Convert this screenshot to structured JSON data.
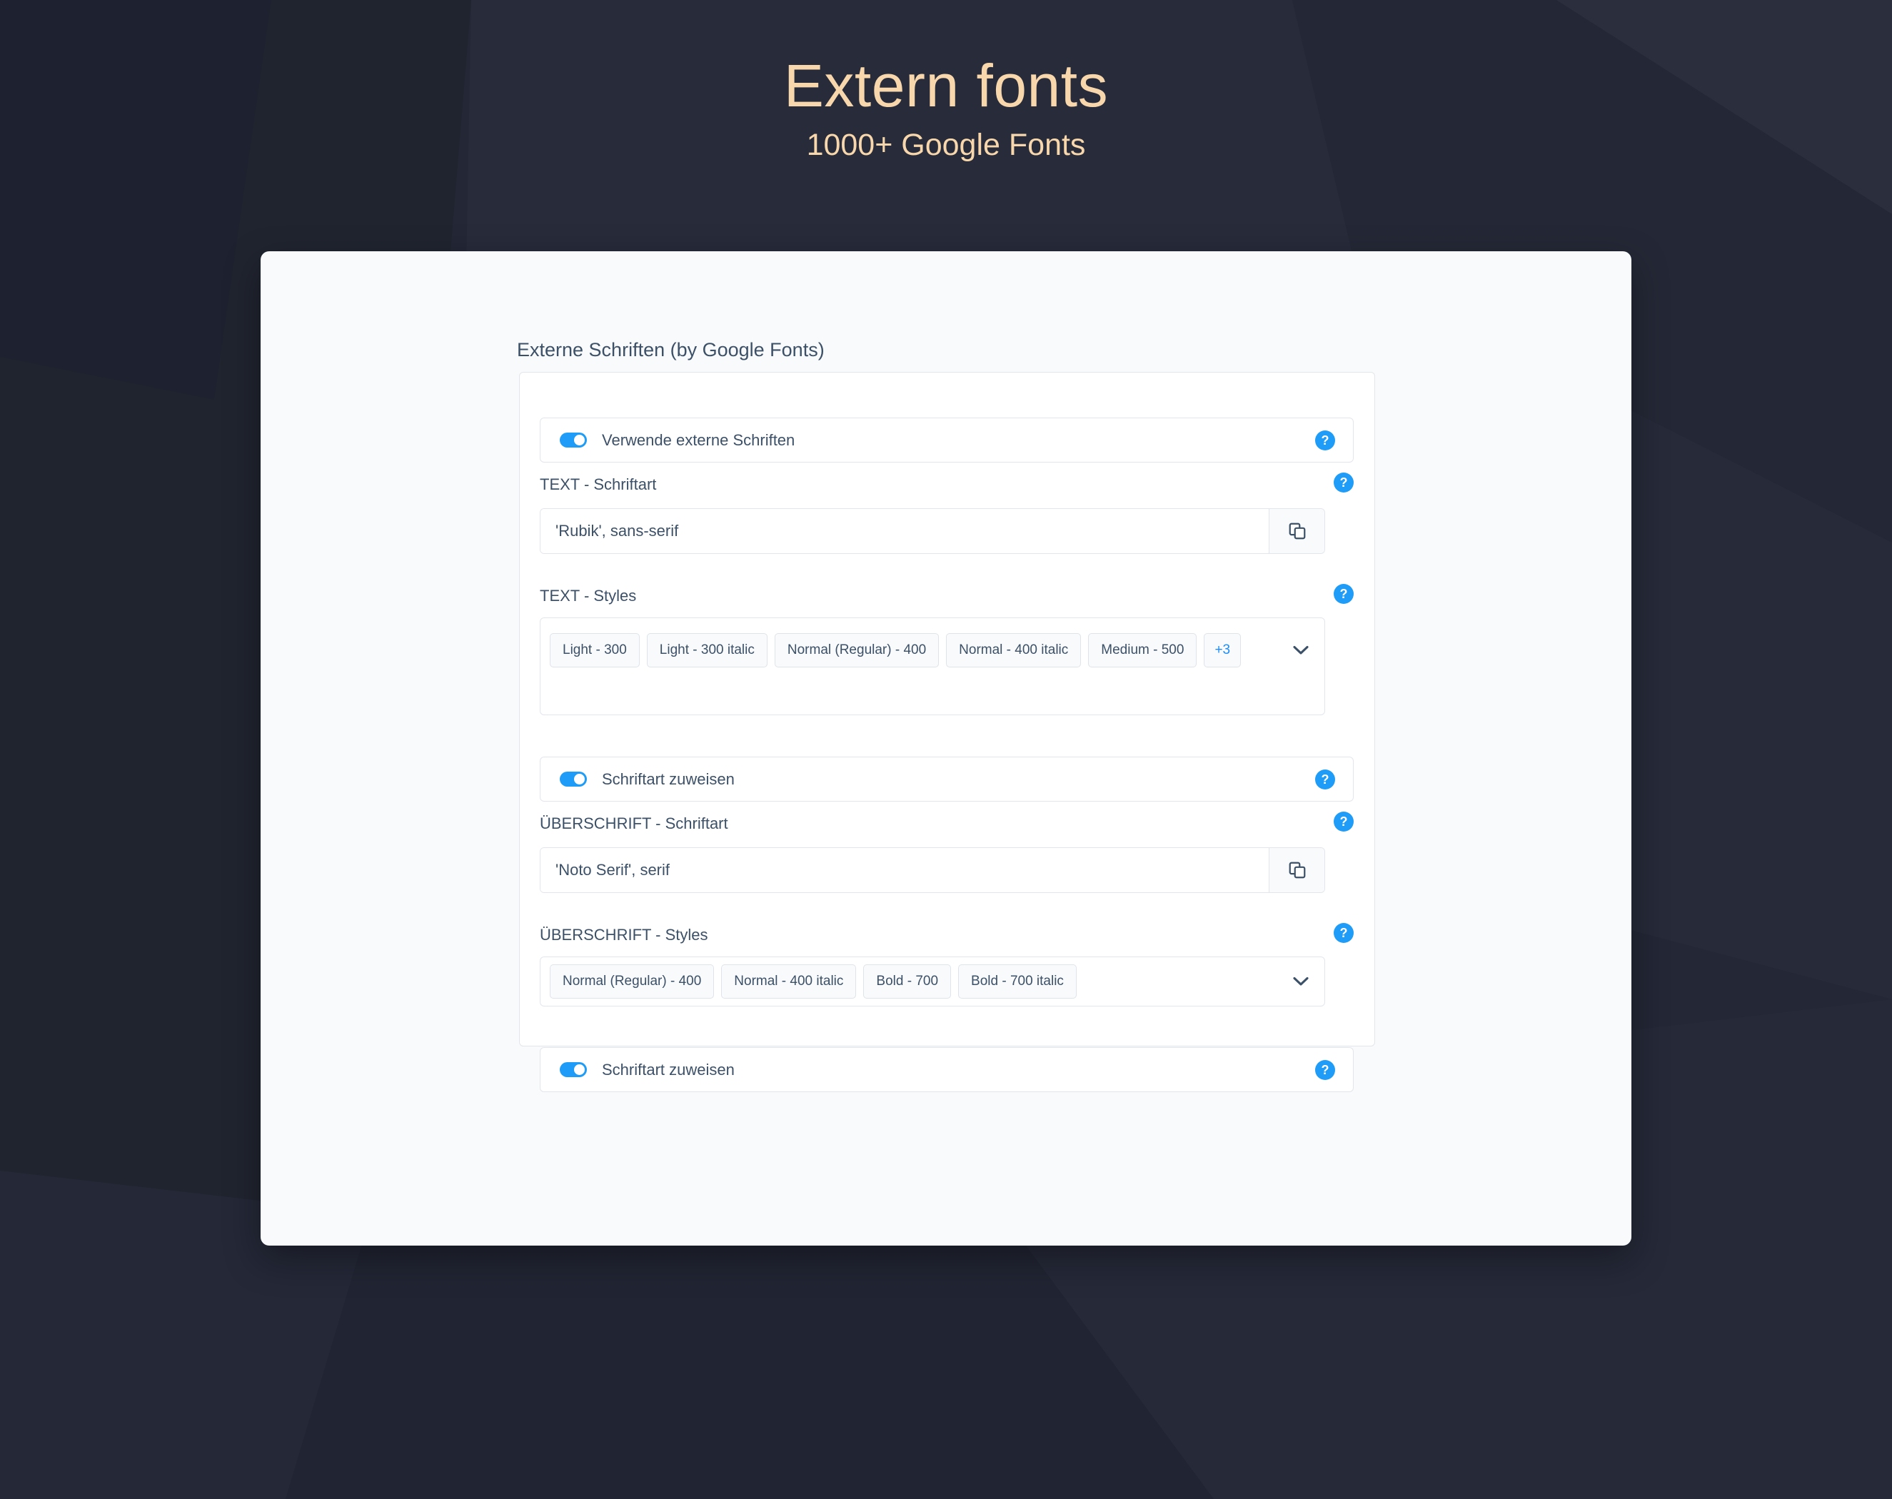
{
  "header": {
    "title": "Extern fonts",
    "subtitle": "1000+ Google Fonts",
    "title_color": "#f7d7ab"
  },
  "panel": {
    "section_title": "Externe Schriften (by Google Fonts)"
  },
  "colors": {
    "accent": "#1f9cf7",
    "link": "#1f8cf7",
    "text": "#3c5068",
    "page_background": "#232736",
    "card_background": "#f9fafb"
  },
  "icons": {
    "help": "?",
    "copy": "copy-icon",
    "chevron_down": "chevron-down-icon"
  },
  "rows": {
    "use_external_fonts": {
      "label": "Verwende externe Schriften",
      "toggle_state": "on",
      "help": "?"
    },
    "text_font": {
      "label": "TEXT - Schriftart",
      "value": "'Rubik', sans-serif",
      "placeholder": "'Rubik', sans-serif",
      "help": "?"
    },
    "text_styles": {
      "label": "TEXT - Styles",
      "help": "?",
      "chips": [
        "Light - 300",
        "Light - 300 italic",
        "Normal (Regular) - 400",
        "Normal - 400 italic",
        "Medium - 500"
      ],
      "more_chip": "+3"
    },
    "assign_font_text": {
      "label": "Schriftart zuweisen",
      "toggle_state": "on",
      "help": "?"
    },
    "heading_font": {
      "label": "ÜBERSCHRIFT - Schriftart",
      "value": "'Noto Serif', serif",
      "placeholder": "'Noto Serif', serif",
      "help": "?"
    },
    "heading_styles": {
      "label": "ÜBERSCHRIFT - Styles",
      "help": "?",
      "chips": [
        "Normal (Regular) - 400",
        "Normal - 400 italic",
        "Bold - 700",
        "Bold - 700 italic"
      ]
    },
    "assign_font_heading": {
      "label": "Schriftart zuweisen",
      "toggle_state": "on",
      "help": "?"
    }
  }
}
